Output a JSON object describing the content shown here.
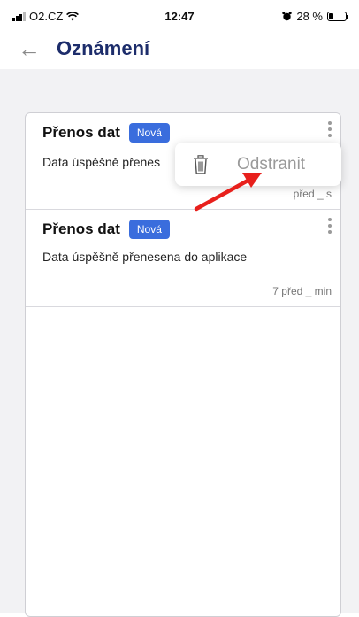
{
  "status_bar": {
    "carrier": "O2.CZ",
    "time": "12:47",
    "battery": "28 %",
    "battery_level": 0.28
  },
  "header": {
    "back_icon": "back-arrow-icon",
    "title": "Oznámení"
  },
  "notifications": [
    {
      "title": "Přenos dat",
      "badge": "Nová",
      "body": "Data úspěšně přenes",
      "time": "před _ s"
    },
    {
      "title": "Přenos dat",
      "badge": "Nová",
      "body": "Data úspěšně přenesena do aplikace",
      "time": "7 před _ min"
    }
  ],
  "context_menu": {
    "delete_label": "Odstranit",
    "icon": "trash-icon"
  },
  "colors": {
    "accent": "#3a6ddd",
    "title": "#1d2d6b",
    "annotation_arrow": "#e8201c"
  }
}
